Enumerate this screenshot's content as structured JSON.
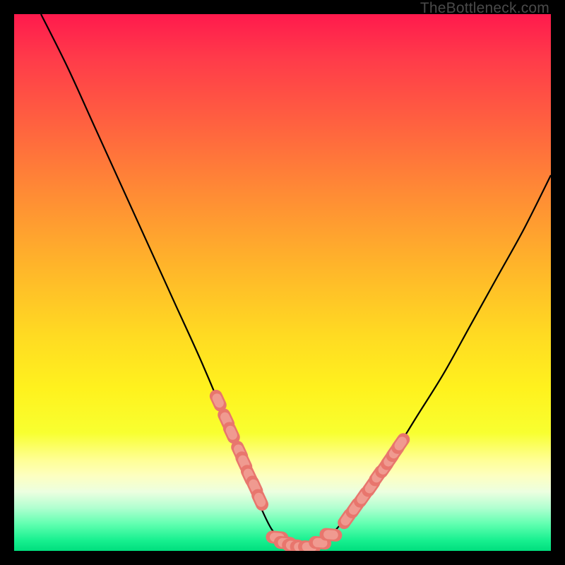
{
  "watermark": "TheBottleneck.com",
  "chart_data": {
    "type": "line",
    "title": "",
    "xlabel": "",
    "ylabel": "",
    "xlim": [
      0,
      100
    ],
    "ylim": [
      0,
      100
    ],
    "grid": false,
    "series": [
      {
        "name": "bottleneck-curve",
        "stroke": "#000000",
        "x": [
          5,
          10,
          15,
          20,
          25,
          30,
          35,
          40,
          43,
          46,
          48,
          50,
          52,
          54,
          56,
          58,
          60,
          65,
          70,
          75,
          80,
          85,
          90,
          95,
          100
        ],
        "y": [
          100,
          90,
          79,
          68,
          57,
          46,
          35,
          23,
          15,
          8,
          4,
          2,
          0.5,
          0,
          0.5,
          2,
          4,
          10,
          17,
          25,
          33,
          42,
          51,
          60,
          70
        ]
      },
      {
        "name": "highlight-dots-left",
        "stroke": "#e8766d",
        "marker": "oval",
        "x": [
          38.0,
          39.5,
          40.5,
          42.0,
          42.8,
          43.8,
          44.8,
          45.8
        ],
        "y": [
          28.0,
          24.5,
          22.0,
          18.5,
          16.5,
          14.0,
          12.0,
          9.5
        ]
      },
      {
        "name": "highlight-dots-bottom",
        "stroke": "#e8766d",
        "marker": "oval",
        "x": [
          49.0,
          50.5,
          52.0,
          53.5,
          55.0,
          57.0,
          59.0
        ],
        "y": [
          2.5,
          1.5,
          1.0,
          0.7,
          0.7,
          1.5,
          3.0
        ]
      },
      {
        "name": "highlight-dots-right",
        "stroke": "#e8766d",
        "marker": "oval",
        "x": [
          62.0,
          63.5,
          65.0,
          66.5,
          67.8,
          69.0,
          70.0,
          71.0,
          72.0
        ],
        "y": [
          6.0,
          8.0,
          10.0,
          12.0,
          14.0,
          15.5,
          17.0,
          18.5,
          20.0
        ]
      }
    ],
    "background_gradient": {
      "direction": "top-to-bottom",
      "stops": [
        {
          "pos": 0.0,
          "color": "#ff1a4d"
        },
        {
          "pos": 0.2,
          "color": "#ff6040"
        },
        {
          "pos": 0.47,
          "color": "#ffb52a"
        },
        {
          "pos": 0.7,
          "color": "#fff21e"
        },
        {
          "pos": 0.86,
          "color": "#fdffc0"
        },
        {
          "pos": 0.95,
          "color": "#60ffb0"
        },
        {
          "pos": 1.0,
          "color": "#00de7d"
        }
      ]
    }
  }
}
